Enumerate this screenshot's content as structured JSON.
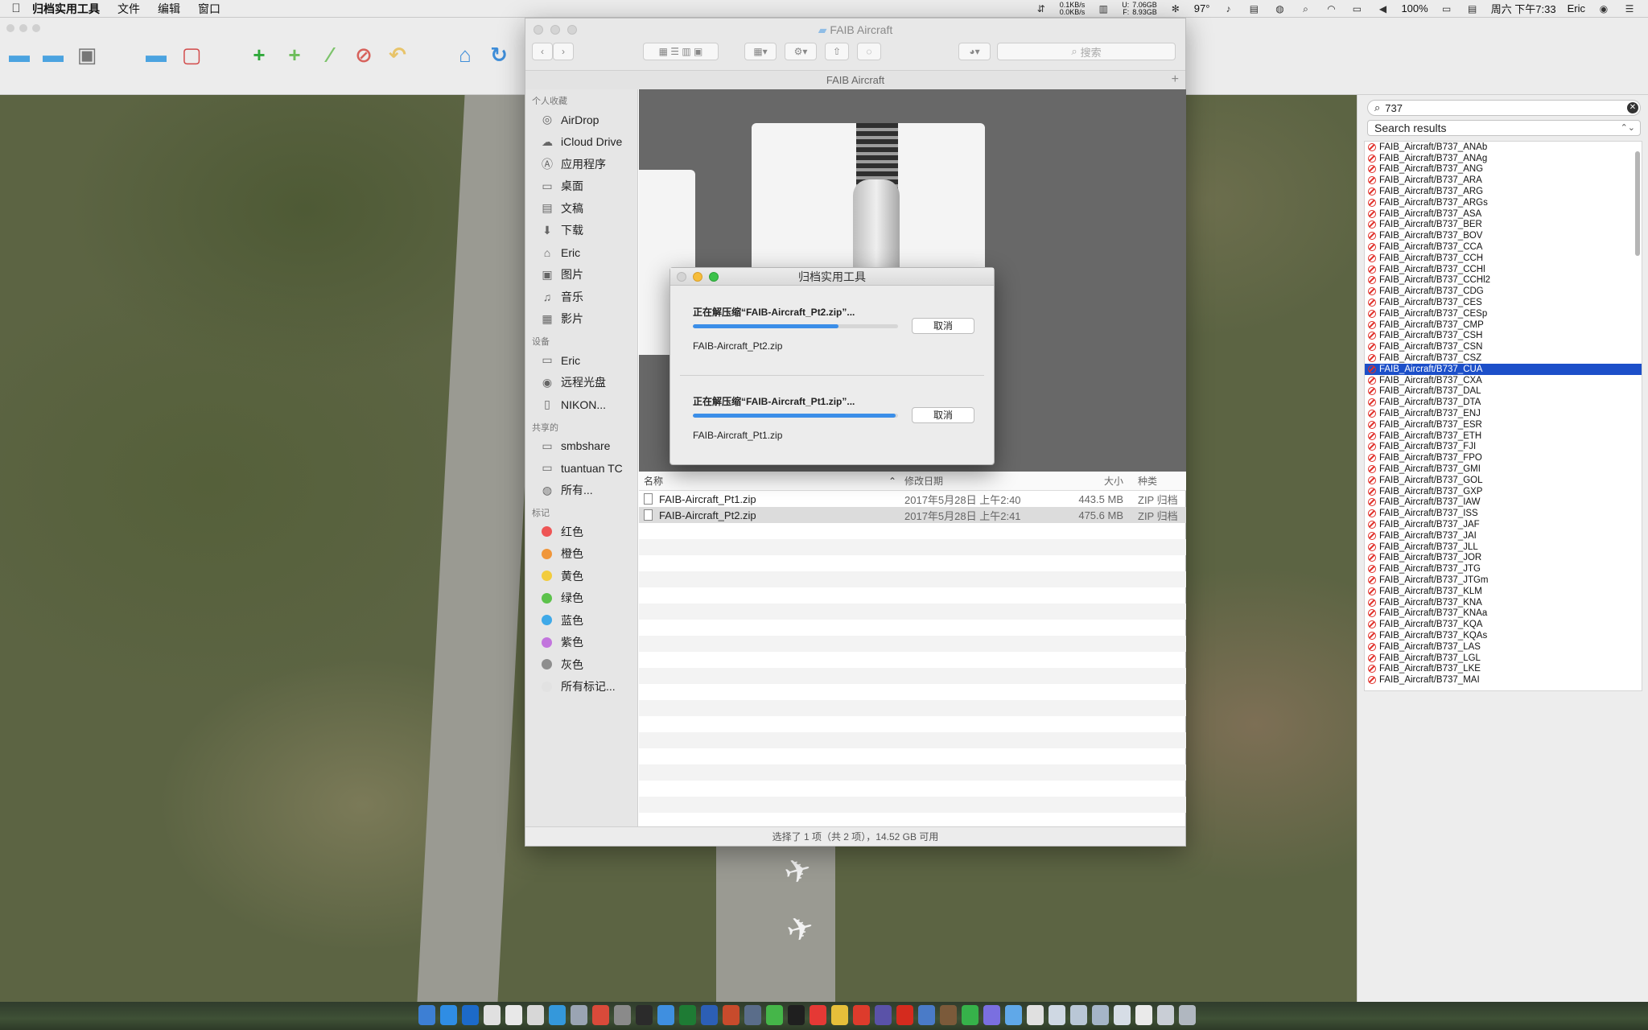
{
  "menubar": {
    "app_name": "归档实用工具",
    "menus": [
      "文件",
      "编辑",
      "窗口"
    ],
    "net_up": "0.1KB/s",
    "net_down": "0.0KB/s",
    "disk_u": "U:",
    "disk_f": "F:",
    "disk_u_val": "7.06GB",
    "disk_f_val": "8.93GB",
    "temperature": "97°",
    "battery": "100%",
    "clock": "周六 下午7:33",
    "user": "Eric"
  },
  "finder": {
    "title": "FAIB Aircraft",
    "path_title": "FAIB Aircraft",
    "search_placeholder": "搜索",
    "sidebar": {
      "favorites_header": "个人收藏",
      "favorites": [
        {
          "label": "AirDrop",
          "icon": "airdrop-icon",
          "glyph": "◎"
        },
        {
          "label": "iCloud Drive",
          "icon": "cloud-icon",
          "glyph": "☁"
        },
        {
          "label": "应用程序",
          "icon": "applications-icon",
          "glyph": "Ⓐ"
        },
        {
          "label": "桌面",
          "icon": "desktop-icon",
          "glyph": "▭"
        },
        {
          "label": "文稿",
          "icon": "documents-icon",
          "glyph": "▤"
        },
        {
          "label": "下载",
          "icon": "downloads-icon",
          "glyph": "⬇"
        },
        {
          "label": "Eric",
          "icon": "home-icon",
          "glyph": "⌂"
        },
        {
          "label": "图片",
          "icon": "pictures-icon",
          "glyph": "▣"
        },
        {
          "label": "音乐",
          "icon": "music-icon",
          "glyph": "♫"
        },
        {
          "label": "影片",
          "icon": "movies-icon",
          "glyph": "▦"
        }
      ],
      "devices_header": "设备",
      "devices": [
        {
          "label": "Eric",
          "icon": "laptop-icon",
          "glyph": "▭"
        },
        {
          "label": "远程光盘",
          "icon": "disc-icon",
          "glyph": "◉"
        },
        {
          "label": "NIKON...",
          "icon": "drive-icon",
          "glyph": "▯"
        }
      ],
      "shared_header": "共享的",
      "shared": [
        {
          "label": "smbshare",
          "icon": "server-icon",
          "glyph": "▭"
        },
        {
          "label": "tuantuan TC",
          "icon": "server-icon",
          "glyph": "▭"
        },
        {
          "label": "所有...",
          "icon": "network-icon",
          "glyph": "◍"
        }
      ],
      "tags_header": "标记",
      "tags": [
        {
          "label": "红色",
          "color": "#ee5555"
        },
        {
          "label": "橙色",
          "color": "#f0963a"
        },
        {
          "label": "黄色",
          "color": "#f2cc3d"
        },
        {
          "label": "绿色",
          "color": "#5cc24b"
        },
        {
          "label": "蓝色",
          "color": "#3fa9e8"
        },
        {
          "label": "紫色",
          "color": "#c275dd"
        },
        {
          "label": "灰色",
          "color": "#8e8e8e"
        },
        {
          "label": "所有标记...",
          "color": "#e2e2e2"
        }
      ]
    },
    "columns": {
      "name": "名称",
      "date": "修改日期",
      "size": "大小",
      "kind": "种类"
    },
    "files": [
      {
        "name": "FAIB-Aircraft_Pt1.zip",
        "date": "2017年5月28日 上午2:40",
        "size": "443.5 MB",
        "kind": "ZIP 归档"
      },
      {
        "name": "FAIB-Aircraft_Pt2.zip",
        "date": "2017年5月28日 上午2:41",
        "size": "475.6 MB",
        "kind": "ZIP 归档"
      }
    ],
    "status": "选择了 1 项（共 2 项），14.52 GB 可用"
  },
  "dialog": {
    "title": "归档实用工具",
    "jobs": [
      {
        "title": "正在解压缩“FAIB-Aircraft_Pt2.zip”...",
        "file": "FAIB-Aircraft_Pt2.zip",
        "progress": 0.71,
        "cancel": "取消"
      },
      {
        "title": "正在解压缩“FAIB-Aircraft_Pt1.zip”...",
        "file": "FAIB-Aircraft_Pt1.zip",
        "progress": 0.99,
        "cancel": "取消"
      }
    ]
  },
  "search_panel": {
    "query": "737",
    "scope": "Search results",
    "selected": "FAIB_Aircraft/B737_CUA",
    "results": [
      "FAIB_Aircraft/B737_ANAb",
      "FAIB_Aircraft/B737_ANAg",
      "FAIB_Aircraft/B737_ANG",
      "FAIB_Aircraft/B737_ARA",
      "FAIB_Aircraft/B737_ARG",
      "FAIB_Aircraft/B737_ARGs",
      "FAIB_Aircraft/B737_ASA",
      "FAIB_Aircraft/B737_BER",
      "FAIB_Aircraft/B737_BOV",
      "FAIB_Aircraft/B737_CCA",
      "FAIB_Aircraft/B737_CCH",
      "FAIB_Aircraft/B737_CCHl",
      "FAIB_Aircraft/B737_CCHl2",
      "FAIB_Aircraft/B737_CDG",
      "FAIB_Aircraft/B737_CES",
      "FAIB_Aircraft/B737_CESp",
      "FAIB_Aircraft/B737_CMP",
      "FAIB_Aircraft/B737_CSH",
      "FAIB_Aircraft/B737_CSN",
      "FAIB_Aircraft/B737_CSZ",
      "FAIB_Aircraft/B737_CUA",
      "FAIB_Aircraft/B737_CXA",
      "FAIB_Aircraft/B737_DAL",
      "FAIB_Aircraft/B737_DTA",
      "FAIB_Aircraft/B737_ENJ",
      "FAIB_Aircraft/B737_ESR",
      "FAIB_Aircraft/B737_ETH",
      "FAIB_Aircraft/B737_FJI",
      "FAIB_Aircraft/B737_FPO",
      "FAIB_Aircraft/B737_GMI",
      "FAIB_Aircraft/B737_GOL",
      "FAIB_Aircraft/B737_GXP",
      "FAIB_Aircraft/B737_IAW",
      "FAIB_Aircraft/B737_ISS",
      "FAIB_Aircraft/B737_JAF",
      "FAIB_Aircraft/B737_JAI",
      "FAIB_Aircraft/B737_JLL",
      "FAIB_Aircraft/B737_JOR",
      "FAIB_Aircraft/B737_JTG",
      "FAIB_Aircraft/B737_JTGm",
      "FAIB_Aircraft/B737_KLM",
      "FAIB_Aircraft/B737_KNA",
      "FAIB_Aircraft/B737_KNAa",
      "FAIB_Aircraft/B737_KQA",
      "FAIB_Aircraft/B737_KQAs",
      "FAIB_Aircraft/B737_LAS",
      "FAIB_Aircraft/B737_LGL",
      "FAIB_Aircraft/B737_LKE",
      "FAIB_Aircraft/B737_MAI"
    ]
  }
}
